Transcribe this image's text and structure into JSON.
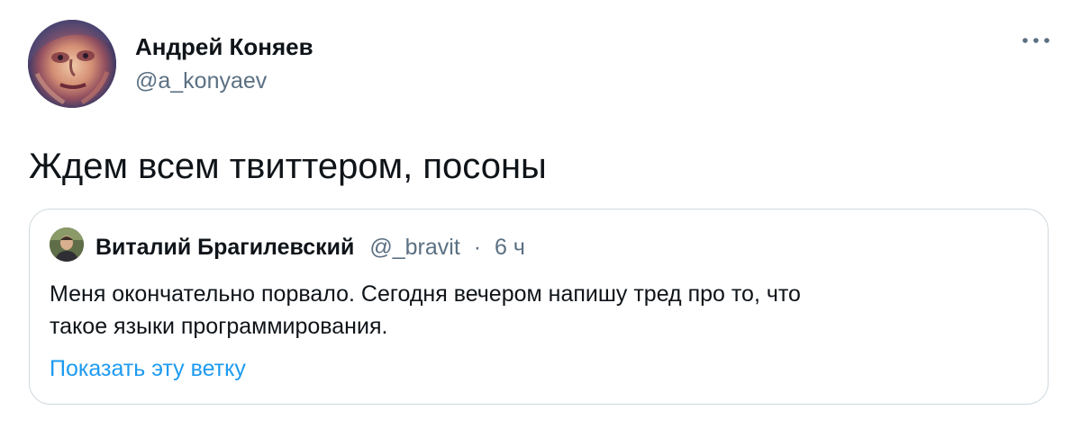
{
  "tweet": {
    "author": {
      "name": "Андрей Коняев",
      "handle": "@a_konyaev"
    },
    "text": "Ждем всем твиттером, посоны",
    "quoted": {
      "author_name": "Виталий Брагилевский",
      "handle": "@_bravit",
      "separator": "·",
      "time": "6 ч",
      "text_line_1": "Меня окончательно порвало. Сегодня вечером напишу тред про то, что",
      "text_line_2": "такое языки программирования.",
      "show_thread_label": "Показать эту ветку"
    }
  },
  "icons": {
    "more": "more-horizontal-icon"
  },
  "colors": {
    "text_primary": "#0f1419",
    "text_secondary": "#5b7083",
    "link": "#1d9bf0",
    "border": "#cfd9de"
  }
}
